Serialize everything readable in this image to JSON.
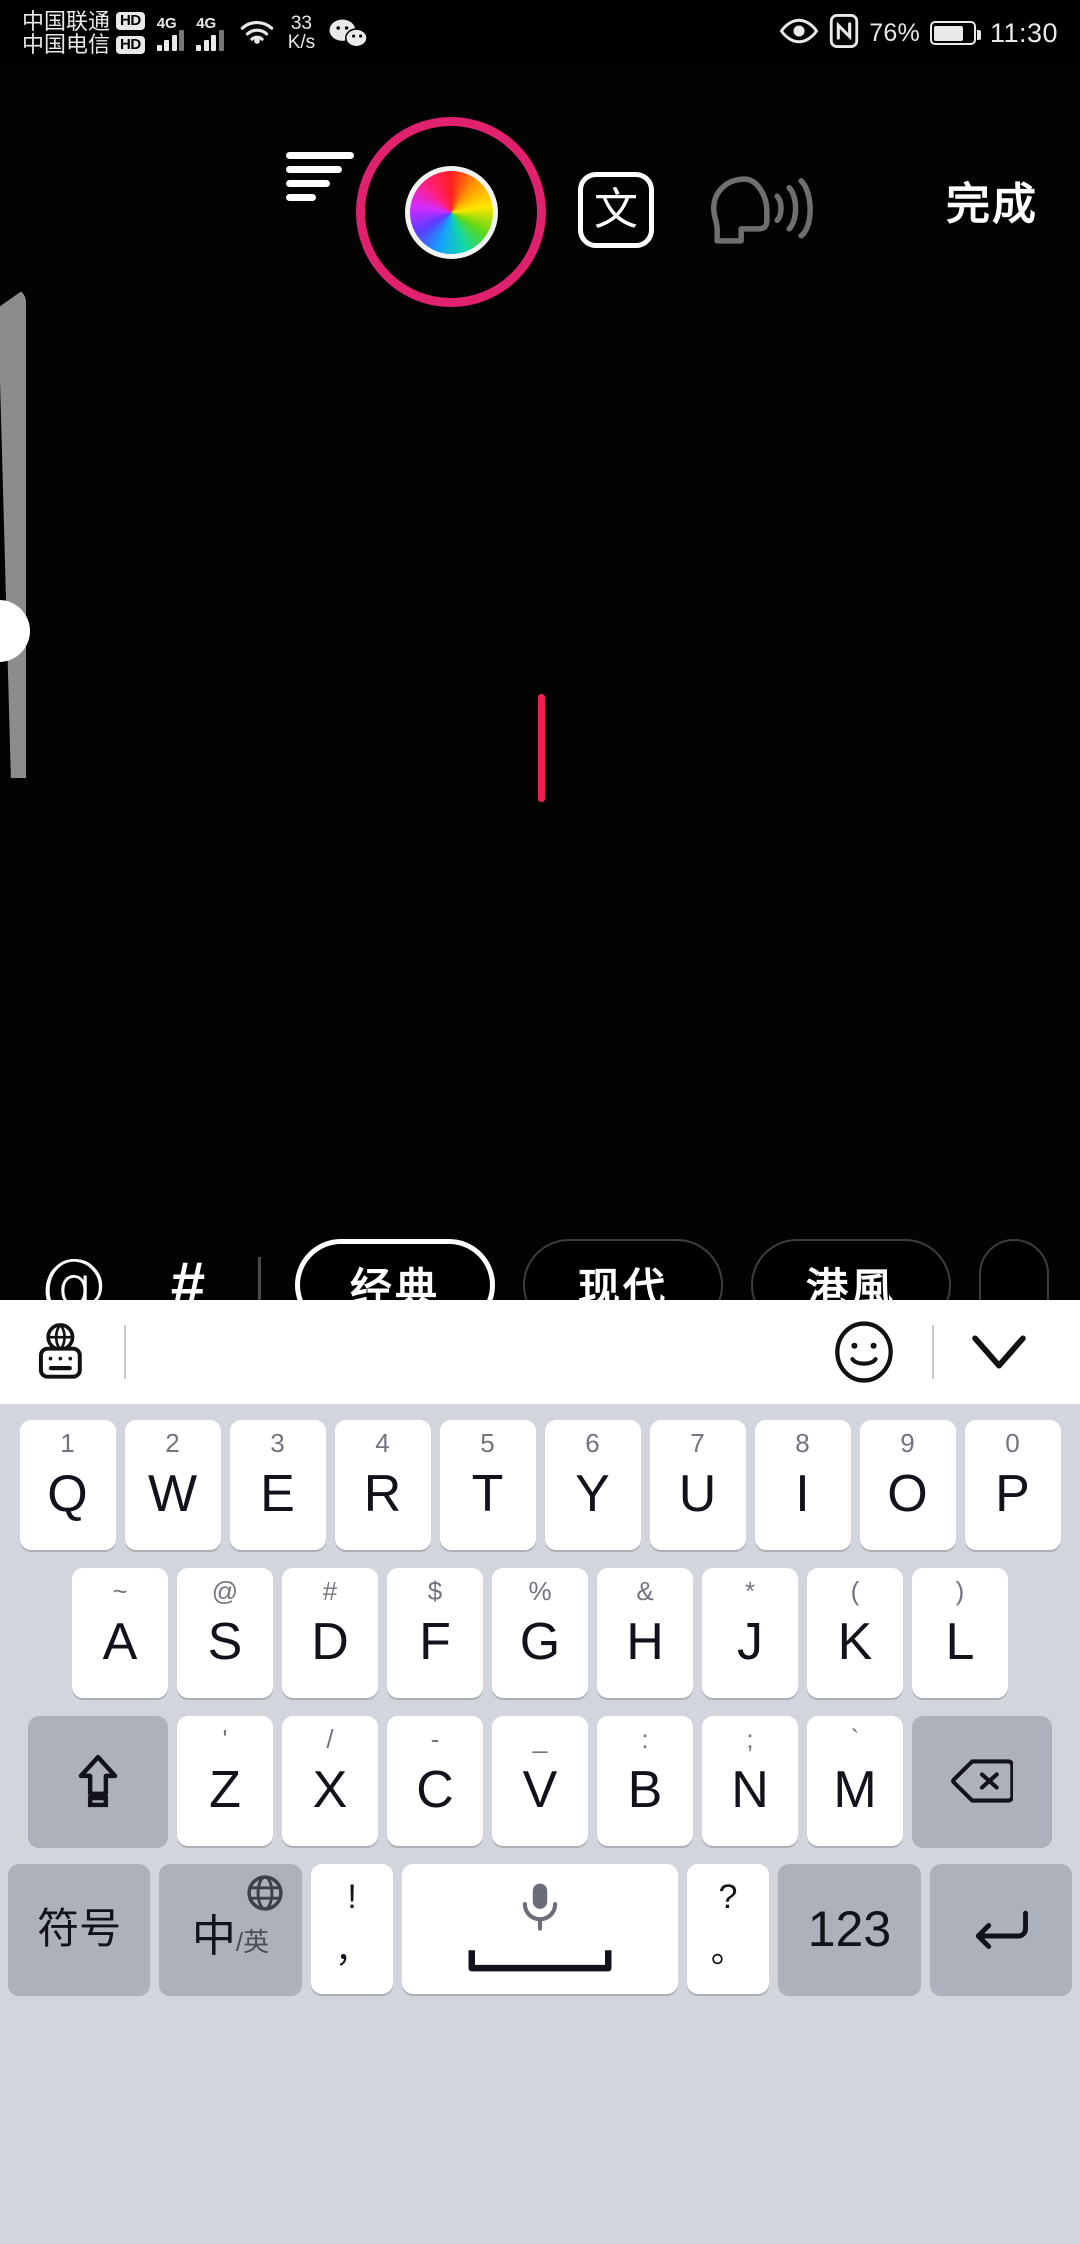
{
  "status_bar": {
    "carrier_1": "中国联通",
    "carrier_1_badge": "HD",
    "carrier_2": "中国电信",
    "carrier_2_badge": "HD",
    "network_1": "4G",
    "network_2": "4G",
    "net_speed_value": "33",
    "net_speed_unit": "K/s",
    "battery_percent": "76%",
    "time": "11:30",
    "icons": [
      "wifi-icon",
      "wechat-icon",
      "eye-icon",
      "nfc-icon",
      "battery-icon"
    ]
  },
  "editor": {
    "toolbar": {
      "align_icon": "text-align-icon",
      "color_icon": "color-wheel-icon",
      "color_ring_hex": "#e0216e",
      "font_icon_label": "文",
      "read_aloud_icon": "text-to-speech-icon",
      "done_label": "完成"
    },
    "caret_color_hex": "#ee1d52",
    "size_slider": {
      "name": "font-size-slider"
    }
  },
  "style_bar": {
    "mention_icon": "@",
    "hashtag_icon": "#",
    "styles": [
      {
        "label": "经典",
        "selected": true
      },
      {
        "label": "现代",
        "selected": false
      },
      {
        "label": "港風",
        "selected": false
      },
      {
        "label": "",
        "selected": false
      }
    ]
  },
  "keyboard": {
    "toolbar": {
      "left_icon": "globe-keyboard-switch-icon",
      "emoji_icon": "emoji-smiley-icon",
      "hide_icon": "chevron-down-icon"
    },
    "row1": [
      {
        "main": "Q",
        "sup": "1"
      },
      {
        "main": "W",
        "sup": "2"
      },
      {
        "main": "E",
        "sup": "3"
      },
      {
        "main": "R",
        "sup": "4"
      },
      {
        "main": "T",
        "sup": "5"
      },
      {
        "main": "Y",
        "sup": "6"
      },
      {
        "main": "U",
        "sup": "7"
      },
      {
        "main": "I",
        "sup": "8"
      },
      {
        "main": "O",
        "sup": "9"
      },
      {
        "main": "P",
        "sup": "0"
      }
    ],
    "row2": [
      {
        "main": "A",
        "sup": "~"
      },
      {
        "main": "S",
        "sup": "@"
      },
      {
        "main": "D",
        "sup": "#"
      },
      {
        "main": "F",
        "sup": "$"
      },
      {
        "main": "G",
        "sup": "%"
      },
      {
        "main": "H",
        "sup": "&"
      },
      {
        "main": "J",
        "sup": "*"
      },
      {
        "main": "K",
        "sup": "("
      },
      {
        "main": "L",
        "sup": ")"
      }
    ],
    "row3": [
      {
        "main": "Z",
        "sup": "'"
      },
      {
        "main": "X",
        "sup": "/"
      },
      {
        "main": "C",
        "sup": "-"
      },
      {
        "main": "V",
        "sup": "_"
      },
      {
        "main": "B",
        "sup": ":"
      },
      {
        "main": "N",
        "sup": ";"
      },
      {
        "main": "M",
        "sup": "`"
      }
    ],
    "shift_icon": "shift-icon",
    "delete_icon": "backspace-icon",
    "row4": {
      "symbol_label": "符号",
      "lang_cn": "中",
      "lang_slash": "/",
      "lang_en": "英",
      "lang_globe_icon": "globe-icon",
      "comma_sup": "!",
      "comma_main": "，",
      "space_icon": "microphone-icon",
      "period_sup": "?",
      "period_main": "。",
      "num_label": "123",
      "return_icon": "enter-icon"
    }
  }
}
